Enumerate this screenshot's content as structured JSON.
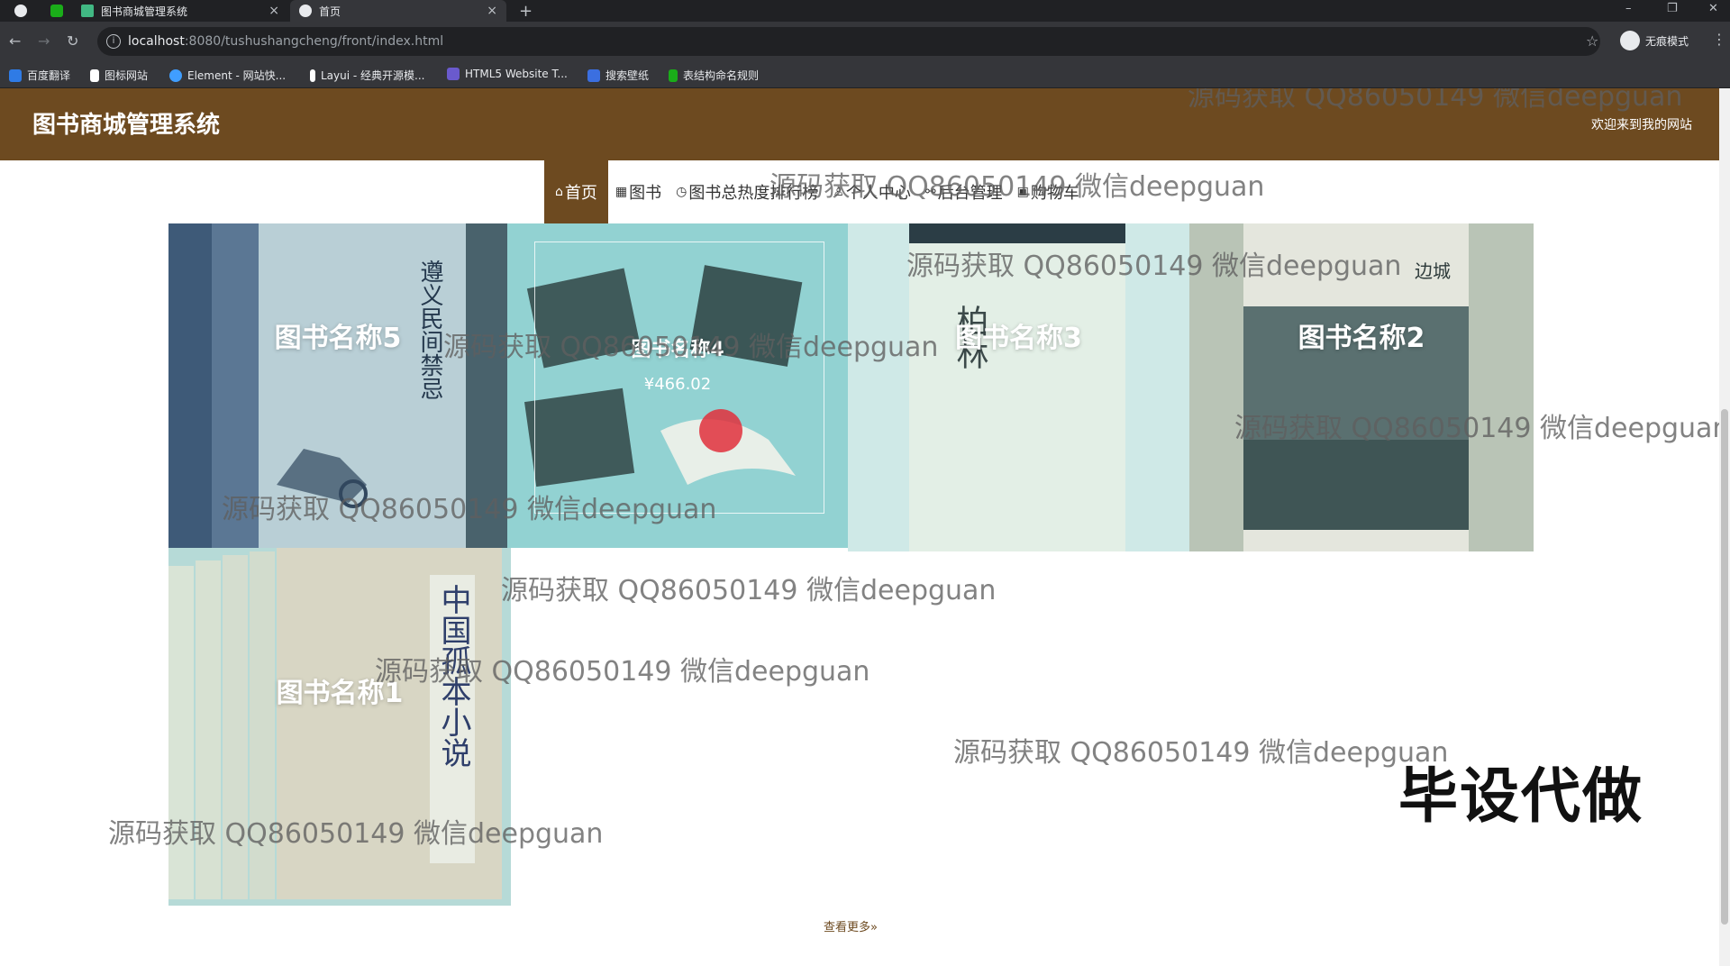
{
  "browser": {
    "tabs": [
      {
        "title": "图书商城管理系统",
        "active": false
      },
      {
        "title": "首页",
        "active": true
      }
    ],
    "new_tab": "+",
    "url_host": "localhost",
    "url_path": ":8080/tushushangcheng/front/index.html",
    "incognito_label": "无痕模式",
    "window_controls": [
      "–",
      "❐",
      "✕"
    ],
    "bookmarks": [
      {
        "label": "百度翻译",
        "color": "#2f7be5"
      },
      {
        "label": "图标网站",
        "color": "#ffffff"
      },
      {
        "label": "Element - 网站快...",
        "color": "#409eff"
      },
      {
        "label": "Layui - 经典开源模...",
        "color": "#ffffff"
      },
      {
        "label": "HTML5 Website T...",
        "color": "#6a5acd"
      },
      {
        "label": "搜索壁纸",
        "color": "#3b6fe0"
      },
      {
        "label": "表结构命名规则",
        "color": "#1aad19"
      }
    ]
  },
  "site": {
    "title": "图书商城管理系统",
    "welcome": "欢迎来到我的网站",
    "brand_color": "#6d4a20",
    "nav": [
      {
        "icon": "⌂",
        "label": "首页",
        "active": true
      },
      {
        "icon": "▦",
        "label": "图书",
        "active": false
      },
      {
        "icon": "◷",
        "label": "图书总热度排行榜",
        "active": false
      },
      {
        "icon": "♙",
        "label": "个人中心",
        "active": false
      },
      {
        "icon": "⚯",
        "label": "后台管理",
        "active": false
      },
      {
        "icon": "▣",
        "label": "购物车",
        "active": false
      }
    ]
  },
  "books": [
    {
      "title": "图书名称5",
      "cover_text": "遵义民间禁忌"
    },
    {
      "title": "图书名称4",
      "price": "¥466.02",
      "hovered": true
    },
    {
      "title": "图书名称3",
      "cover_text": "柏林"
    },
    {
      "title": "图书名称2",
      "cover_text": "边城"
    },
    {
      "title": "图书名称1",
      "cover_text": "中国孤本小说"
    }
  ],
  "view_more": "查看更多»",
  "watermark_text": "源码获取 QQ86050149 微信deepguan",
  "promo": "毕设代做"
}
